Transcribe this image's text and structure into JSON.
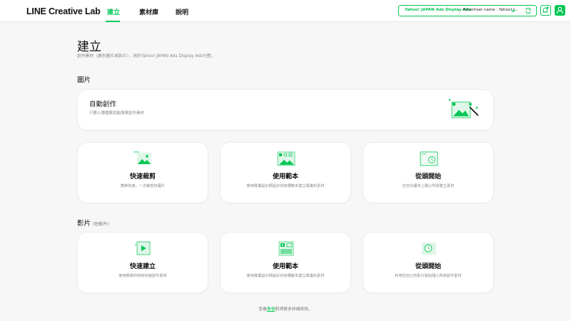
{
  "header": {
    "logo": "LINE Creative Lab",
    "tabs": [
      {
        "label": "建立",
        "active": true
      },
      {
        "label": "素材庫",
        "active": false
      },
      {
        "label": "說明",
        "active": false
      }
    ],
    "account": {
      "platform": "Yahoo! JAPAN Ads Display Ads",
      "advertiser": "Advertiser name : Yahoo! J..."
    }
  },
  "page": {
    "title": "建立",
    "description": "創作素材（廣告圖片或影片），用於Yahoo! JAPAN Ads Display Ads刊登。"
  },
  "images_section": {
    "title": "圖片",
    "auto": {
      "title": "自動創作",
      "description": "只要上傳檔案就能簡單創作素材"
    },
    "cards": [
      {
        "title": "快速裁剪",
        "description": "簡單快速，一次裁剪好圖片"
      },
      {
        "title": "使用範本",
        "description": "使用專業設計師設計的各種範本建立專業的素材"
      },
      {
        "title": "從頭開始",
        "description": "在空白畫布上隨心所欲建立素材"
      }
    ]
  },
  "videos_section": {
    "title": "影片",
    "subtitle": "(短影片)",
    "cards": [
      {
        "title": "快速建立",
        "description": "使用簡單的特效快速創作素材"
      },
      {
        "title": "使用範本",
        "description": "使用專業設計師設計的各種範本建立專業的素材"
      },
      {
        "title": "從頭開始",
        "description": "利用您自己的影片開始隨心所欲創作素材"
      }
    ]
  },
  "footer": {
    "prefix": "查看",
    "link": "教學",
    "suffix": "取得更多詳細資訊。"
  },
  "colors": {
    "accent": "#06c755",
    "accent_light": "#dff6e8",
    "background": "#f7f7f7",
    "card": "#ffffff"
  },
  "icons": {
    "account_chevron": "chevron-down-icon",
    "account_switch": "switch-account-icon",
    "bell": "bell-icon",
    "user": "user-icon",
    "auto_create": "magic-image-icon",
    "quick_crop": "crop-image-icon",
    "template": "template-image-icon",
    "from_scratch": "blank-canvas-icon",
    "quick_video": "video-play-icon",
    "video_template": "video-template-icon",
    "video_scratch": "video-clock-icon"
  }
}
